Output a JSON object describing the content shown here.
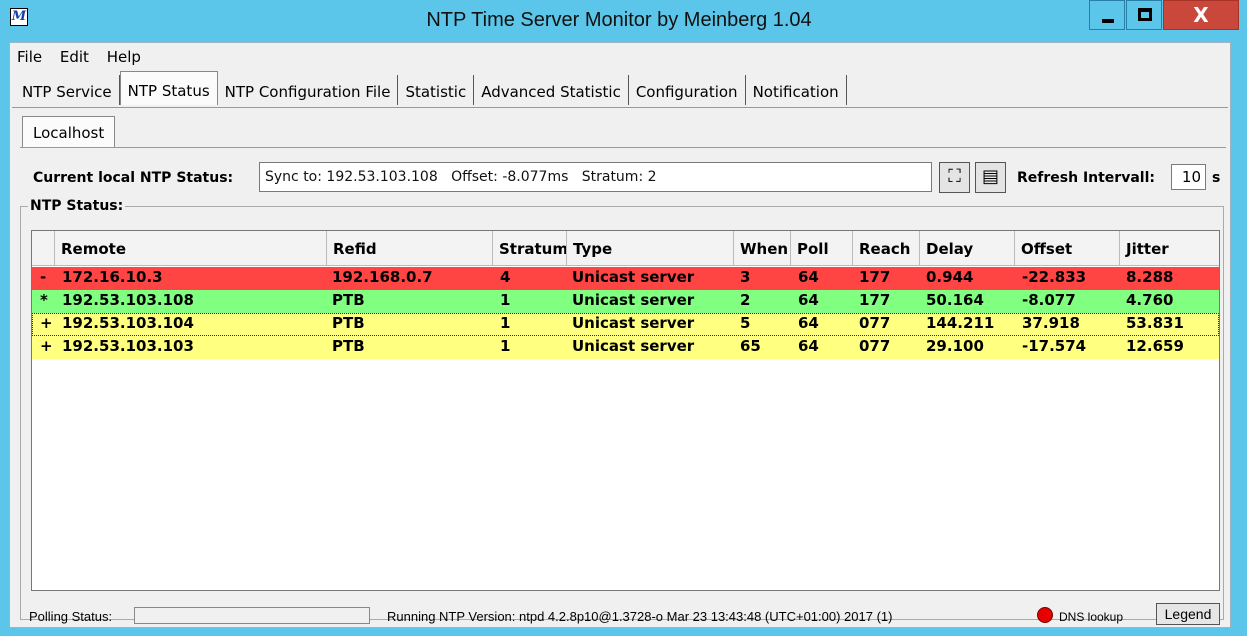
{
  "window": {
    "title": "NTP Time Server Monitor by Meinberg 1.04",
    "app_icon_glyph": "M",
    "close_glyph": "X"
  },
  "menu": [
    "File",
    "Edit",
    "Help"
  ],
  "tabs": [
    "NTP Service",
    "NTP Status",
    "NTP Configuration File",
    "Statistic",
    "Advanced Statistic",
    "Configuration",
    "Notification"
  ],
  "active_tab": "NTP Status",
  "subtab": "Localhost",
  "status": {
    "label": "Current local NTP Status:",
    "value": "Sync to: 192.53.103.108   Offset: -8.077ms   Stratum: 2",
    "refresh_label": "Refresh Intervall:",
    "refresh_value": "10",
    "refresh_unit": "s"
  },
  "group_title": "NTP Status:",
  "columns": [
    "",
    "Remote",
    "Refid",
    "Stratum",
    "Type",
    "When",
    "Poll",
    "Reach",
    "Delay",
    "Offset",
    "Jitter"
  ],
  "rows": [
    {
      "flag": "-",
      "remote": "172.16.10.3",
      "refid": "192.168.0.7",
      "stratum": "4",
      "type": "Unicast server",
      "when": "3",
      "poll": "64",
      "reach": "177",
      "delay": "0.944",
      "offset": "-22.833",
      "jitter": "8.288",
      "color": "#ff4444"
    },
    {
      "flag": "*",
      "remote": "192.53.103.108",
      "refid": "PTB",
      "stratum": "1",
      "type": "Unicast server",
      "when": "2",
      "poll": "64",
      "reach": "177",
      "delay": "50.164",
      "offset": "-8.077",
      "jitter": "4.760",
      "color": "#80ff80"
    },
    {
      "flag": "+",
      "remote": "192.53.103.104",
      "refid": "PTB",
      "stratum": "1",
      "type": "Unicast server",
      "when": "5",
      "poll": "64",
      "reach": "077",
      "delay": "144.211",
      "offset": "37.918",
      "jitter": "53.831",
      "color": "#ffff80"
    },
    {
      "flag": "+",
      "remote": "192.53.103.103",
      "refid": "PTB",
      "stratum": "1",
      "type": "Unicast server",
      "when": "65",
      "poll": "64",
      "reach": "077",
      "delay": "29.100",
      "offset": "-17.574",
      "jitter": "12.659",
      "color": "#ffff80"
    }
  ],
  "bottom": {
    "polling_label": "Polling Status:",
    "ntp_version": "Running NTP Version:  ntpd 4.2.8p10@1.3728-o Mar 23 13:43:48 (UTC+01:00) 2017  (1)",
    "dns_label": "DNS lookup",
    "legend_button": "Legend"
  }
}
